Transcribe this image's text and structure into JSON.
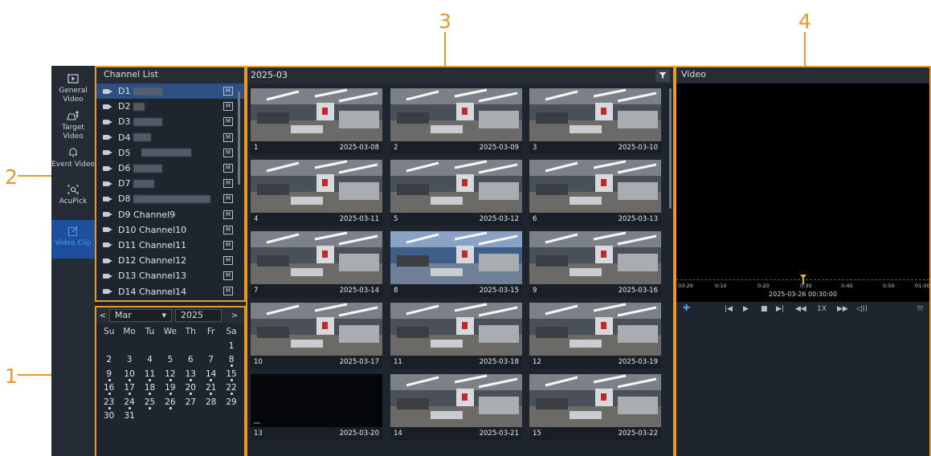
{
  "callouts": [
    "1",
    "2",
    "3",
    "4"
  ],
  "nav": {
    "items": [
      {
        "label": "General Video",
        "icon": "play-icon"
      },
      {
        "label": "Target Video",
        "icon": "target-person-icon"
      },
      {
        "label": "Event Video",
        "icon": "bell-icon"
      },
      {
        "label": "AcuPick",
        "icon": "acupick-icon"
      },
      {
        "label": "Video Clip",
        "icon": "edit-clip-icon",
        "active": true
      }
    ]
  },
  "channel_list": {
    "title": "Channel List",
    "items": [
      {
        "label": "D1",
        "badge": "M"
      },
      {
        "label": "D2",
        "badge": "M"
      },
      {
        "label": "D3",
        "badge": "M"
      },
      {
        "label": "D4",
        "badge": "M"
      },
      {
        "label": "D5",
        "badge": "M"
      },
      {
        "label": "D6",
        "badge": "M"
      },
      {
        "label": "D7",
        "badge": "M"
      },
      {
        "label": "D8",
        "badge": "M"
      },
      {
        "label": "D9 Channel9",
        "badge": "M"
      },
      {
        "label": "D10 Channel10",
        "badge": "M"
      },
      {
        "label": "D11 Channel11",
        "badge": "M"
      },
      {
        "label": "D12 Channel12",
        "badge": "M"
      },
      {
        "label": "D13 Channel13",
        "badge": "M"
      },
      {
        "label": "D14 Channel14",
        "badge": "M"
      }
    ]
  },
  "calendar": {
    "prev": "<",
    "next": ">",
    "month": "Mar",
    "year": "2025",
    "weekdays": [
      "Su",
      "Mo",
      "Tu",
      "We",
      "Th",
      "Fr",
      "Sa"
    ],
    "weeks": [
      [
        "",
        "",
        "",
        "",
        "",
        "",
        "1"
      ],
      [
        "2",
        "3",
        "4",
        "5",
        "6",
        "7",
        "8"
      ],
      [
        "9",
        "10",
        "11",
        "12",
        "13",
        "14",
        "15"
      ],
      [
        "16",
        "17",
        "18",
        "19",
        "20",
        "21",
        "22"
      ],
      [
        "23",
        "24",
        "25",
        "26",
        "27",
        "28",
        "29"
      ],
      [
        "30",
        "31",
        "",
        "",
        "",
        "",
        ""
      ]
    ],
    "record_days": [
      "8",
      "9",
      "10",
      "11",
      "12",
      "13",
      "14",
      "15",
      "16",
      "17",
      "18",
      "19",
      "20",
      "21",
      "22",
      "23",
      "24",
      "25",
      "26"
    ]
  },
  "thumbnails": {
    "month": "2025-03",
    "items": [
      {
        "index": "1",
        "date": "2025-03-08"
      },
      {
        "index": "2",
        "date": "2025-03-09"
      },
      {
        "index": "3",
        "date": "2025-03-10"
      },
      {
        "index": "4",
        "date": "2025-03-11"
      },
      {
        "index": "5",
        "date": "2025-03-12"
      },
      {
        "index": "6",
        "date": "2025-03-13"
      },
      {
        "index": "7",
        "date": "2025-03-14"
      },
      {
        "index": "8",
        "date": "2025-03-15"
      },
      {
        "index": "9",
        "date": "2025-03-16"
      },
      {
        "index": "10",
        "date": "2025-03-17"
      },
      {
        "index": "11",
        "date": "2025-03-18"
      },
      {
        "index": "12",
        "date": "2025-03-19"
      },
      {
        "index": "13",
        "date": "2025-03-20"
      },
      {
        "index": "14",
        "date": "2025-03-21"
      },
      {
        "index": "15",
        "date": "2025-03-22"
      }
    ]
  },
  "video": {
    "title": "Video",
    "timeline_labels": [
      "03-26",
      "0:10",
      "0:20",
      "0:30",
      "0:40",
      "0:50",
      "01:00"
    ],
    "timestamp": "2025-03-26 00:30:00",
    "speed": "1X"
  }
}
